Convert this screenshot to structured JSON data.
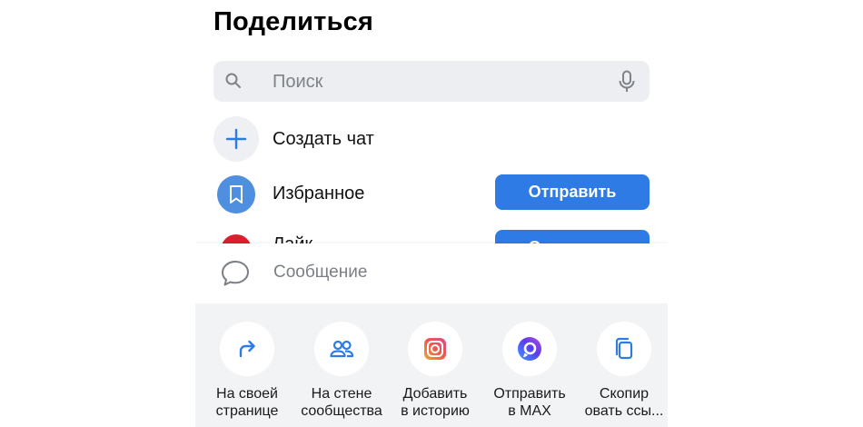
{
  "share": {
    "title": "Поделиться",
    "search": {
      "placeholder": "Поиск"
    },
    "create_chat": {
      "label": "Создать чат"
    },
    "favorites": {
      "label": "Избранное",
      "send_label": "Отправить"
    },
    "partial_contact": {
      "label": "Лайк",
      "send_label": "Отправить"
    },
    "message": {
      "placeholder": "Сообщение"
    },
    "actions": [
      {
        "icon": "share-arrow-icon",
        "label": "На своей\nстранице"
      },
      {
        "icon": "community-icon",
        "label": "На стене\nсообщества"
      },
      {
        "icon": "instagram-icon",
        "label": "Добавить\nв историю"
      },
      {
        "icon": "max-icon",
        "label": "Отправить\nв MAX"
      },
      {
        "icon": "copy-icon",
        "label": "Скопир\nовать ссы..."
      }
    ]
  },
  "colors": {
    "accent": "#2e7be6",
    "favorites": "#4e8fe0",
    "panel": "#f2f3f5"
  }
}
